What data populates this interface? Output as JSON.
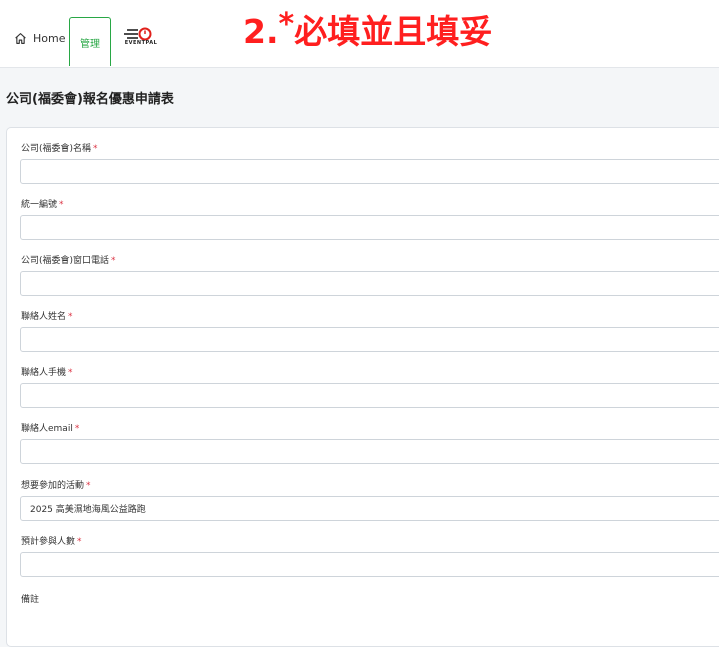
{
  "nav": {
    "home_label": "Home",
    "admin_label": "管理",
    "logo_text": "EVENTPAL"
  },
  "annotation": {
    "prefix": "2.",
    "star": "*",
    "text": "必填並且填妥"
  },
  "page_title": "公司(福委會)報名優惠申請表",
  "form": {
    "fields": [
      {
        "label": "公司(福委會)名稱",
        "required": "*",
        "value": ""
      },
      {
        "label": "統一編號",
        "required": "*",
        "value": ""
      },
      {
        "label": "公司(福委會)窗口電話",
        "required": "*",
        "value": ""
      },
      {
        "label": "聯絡人姓名",
        "required": "*",
        "value": ""
      },
      {
        "label": "聯絡人手機",
        "required": "*",
        "value": ""
      },
      {
        "label": "聯絡人email",
        "required": "*",
        "value": ""
      },
      {
        "label": "想要參加的活動",
        "required": "*",
        "value": "2025 高美濕地海風公益路跑"
      },
      {
        "label": "預計參與人數",
        "required": "*",
        "value": ""
      },
      {
        "label": "備註",
        "required": "",
        "value": ""
      }
    ]
  },
  "colors": {
    "accent_green": "#28a745",
    "required_red": "#dc3545",
    "annotation_red": "#ff1f1f"
  }
}
